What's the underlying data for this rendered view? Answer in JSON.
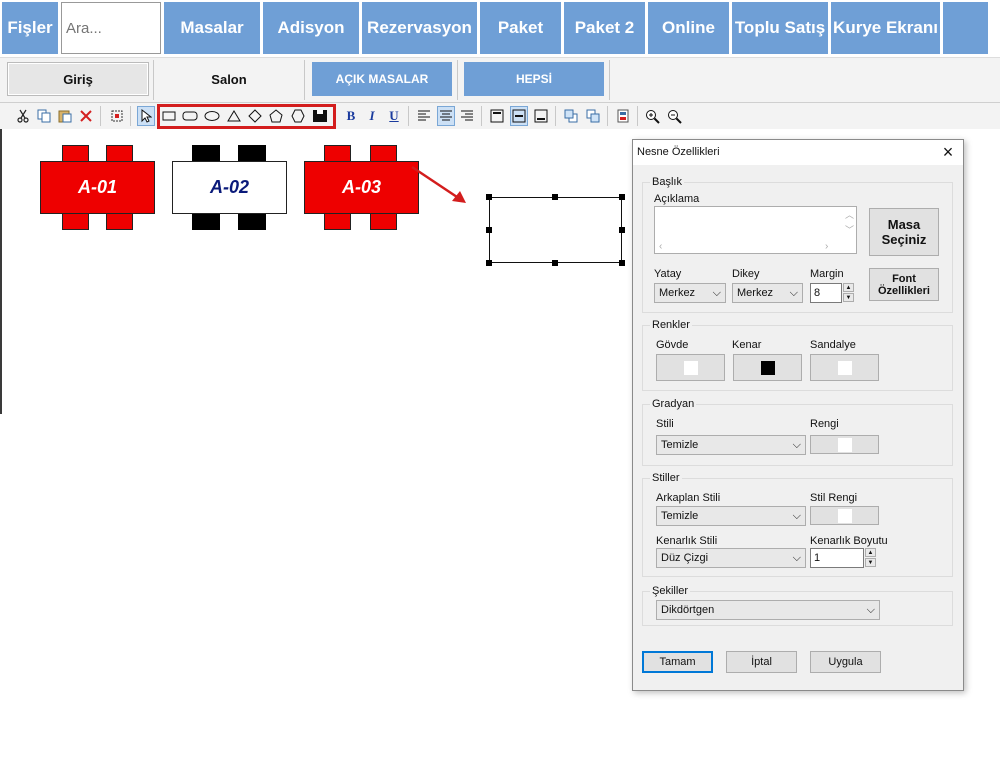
{
  "nav": {
    "fisler": "Fişler",
    "search_placeholder": "Ara...",
    "masalar": "Masalar",
    "adisyon": "Adisyon",
    "rezervasyon": "Rezervasyon",
    "paket": "Paket",
    "paket2": "Paket 2",
    "online": "Online",
    "toplu_satis": "Toplu Satış",
    "kurye_ekrani": "Kurye Ekranı"
  },
  "tabs": {
    "giris": "Giriş",
    "salon": "Salon",
    "acik_masalar": "AÇIK MASALAR",
    "hepsi": "HEPSİ"
  },
  "toolbar": {
    "icons": [
      "cut-icon",
      "copy-icon",
      "paste-icon",
      "delete-icon",
      "select-all-icon",
      "pointer-icon",
      "rectangle-icon",
      "rounded-rectangle-icon",
      "ellipse-icon",
      "triangle-icon",
      "diamond-icon",
      "pentagon-icon",
      "hexagon-icon",
      "table-shape-icon",
      "bold-icon",
      "italic-icon",
      "underline-icon",
      "align-left-icon",
      "align-center-icon",
      "align-right-icon",
      "valign-top-icon",
      "valign-middle-icon",
      "valign-bottom-icon",
      "bring-front-icon",
      "send-back-icon",
      "properties-icon",
      "zoom-in-icon",
      "zoom-out-icon"
    ],
    "bold": "B",
    "italic": "I",
    "underline": "U"
  },
  "canvas": {
    "tables": [
      {
        "label": "A-01",
        "body": "#ee0000",
        "chairs": "#ee0000",
        "text": "#ffffff"
      },
      {
        "label": "A-02",
        "body": "#ffffff",
        "chairs": "#000000",
        "text": "#0a1a7a"
      },
      {
        "label": "A-03",
        "body": "#ee0000",
        "chairs": "#ee0000",
        "text": "#ffffff"
      }
    ]
  },
  "dialog": {
    "title": "Nesne Özellikleri",
    "baslik": "Başlık",
    "aciklama_label": "Açıklama",
    "aciklama_value": "",
    "masa_seciniz": "Masa Seçiniz",
    "yatay_label": "Yatay",
    "yatay_value": "Merkez",
    "dikey_label": "Dikey",
    "dikey_value": "Merkez",
    "margin_label": "Margin",
    "margin_value": "8",
    "font_ozellikleri": "Font Özellikleri",
    "renkler": "Renkler",
    "govde_label": "Gövde",
    "kenar_label": "Kenar",
    "sandalye_label": "Sandalye",
    "govde_color": "#ffffff",
    "kenar_color": "#000000",
    "sandalye_color": "#ffffff",
    "gradyan": "Gradyan",
    "stili_label": "Stili",
    "stili_value": "Temizle",
    "rengi_label": "Rengi",
    "rengi_color": "#ffffff",
    "stiller": "Stiller",
    "arkaplan_stili_label": "Arkaplan Stili",
    "arkaplan_stili_value": "Temizle",
    "stil_rengi_label": "Stil Rengi",
    "stil_rengi_color": "#ffffff",
    "kenarlik_stili_label": "Kenarlık Stili",
    "kenarlik_stili_value": "Düz Çizgi",
    "kenarlik_boyutu_label": "Kenarlık Boyutu",
    "kenarlik_boyutu_value": "1",
    "sekiller": "Şekiller",
    "sekil_value": "Dikdörtgen",
    "tamam": "Tamam",
    "iptal": "İptal",
    "uygula": "Uygula"
  },
  "colors": {
    "nav_blue": "#6f9fd6",
    "highlight_red": "#d31d1d"
  }
}
